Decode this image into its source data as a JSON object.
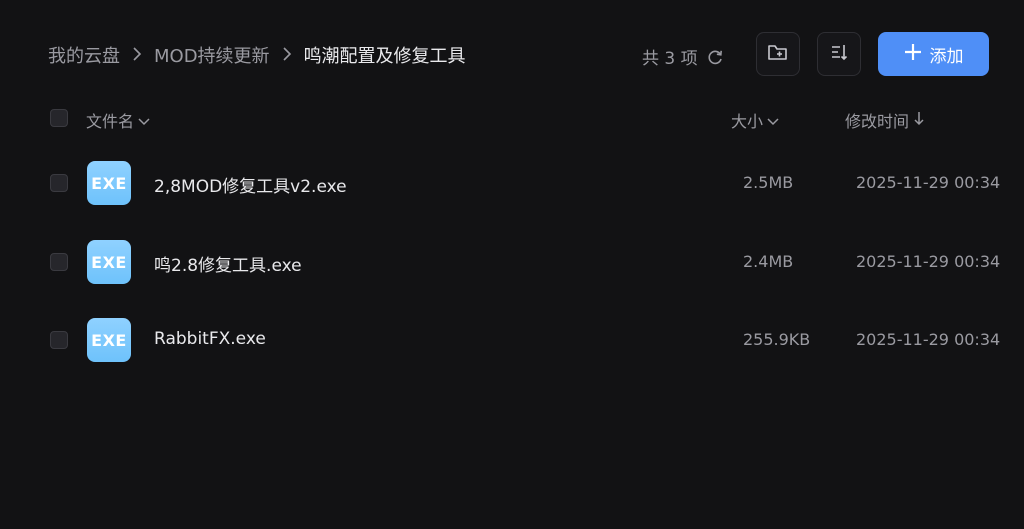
{
  "breadcrumb": {
    "items": [
      "我的云盘",
      "MOD持续更新",
      "鸣潮配置及修复工具"
    ]
  },
  "toolbar": {
    "count_text": "共 3 项",
    "add_label": "添加"
  },
  "table": {
    "headers": {
      "name": "文件名",
      "size": "大小",
      "time": "修改时间"
    },
    "rows": [
      {
        "icon_label": "EXE",
        "name": "2,8MOD修复工具v2.exe",
        "size": "2.5MB",
        "time": "2025-11-29 00:34"
      },
      {
        "icon_label": "EXE",
        "name": "鸣2.8修复工具.exe",
        "size": "2.4MB",
        "time": "2025-11-29 00:34"
      },
      {
        "icon_label": "EXE",
        "name": "RabbitFX.exe",
        "size": "255.9KB",
        "time": "2025-11-29 00:34"
      }
    ]
  },
  "colors": {
    "background": "#121214",
    "accent": "#4f8ff7",
    "exe_icon": "#7cc8fd"
  }
}
